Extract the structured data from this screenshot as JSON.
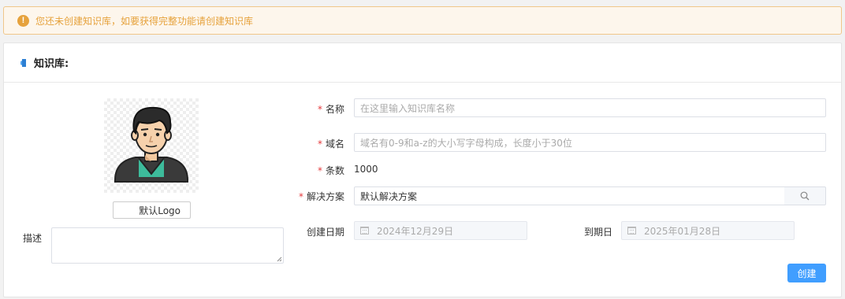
{
  "alert": {
    "icon": "warning-icon",
    "text": "您还未创建知识库，如要获得完整功能请创建知识库"
  },
  "panel": {
    "title": "知识库:",
    "icon": "knowledge-base-icon"
  },
  "avatar": {
    "icon": "user-avatar-icon",
    "logo_button": "默认Logo"
  },
  "form": {
    "name": {
      "label": "名称",
      "required": "*",
      "placeholder": "在这里输入知识库名称"
    },
    "domain": {
      "label": "域名",
      "required": "*",
      "placeholder": "域名有0-9和a-z的大小写字母构成，长度小于30位"
    },
    "count": {
      "label": "条数",
      "required": "*",
      "value": "1000"
    },
    "solution": {
      "label": "解决方案",
      "required": "*",
      "value": "默认解决方案",
      "icon": "search-icon"
    },
    "created": {
      "label": "创建日期",
      "value": "2024年12月29日",
      "icon": "calendar-icon"
    },
    "expires": {
      "label": "到期日",
      "value": "2025年01月28日",
      "icon": "calendar-icon"
    },
    "description": {
      "label": "描述",
      "value": ""
    },
    "submit": "创建"
  },
  "colors": {
    "accent": "#409eff",
    "warning": "#e6a23c",
    "required": "#e4393c"
  }
}
